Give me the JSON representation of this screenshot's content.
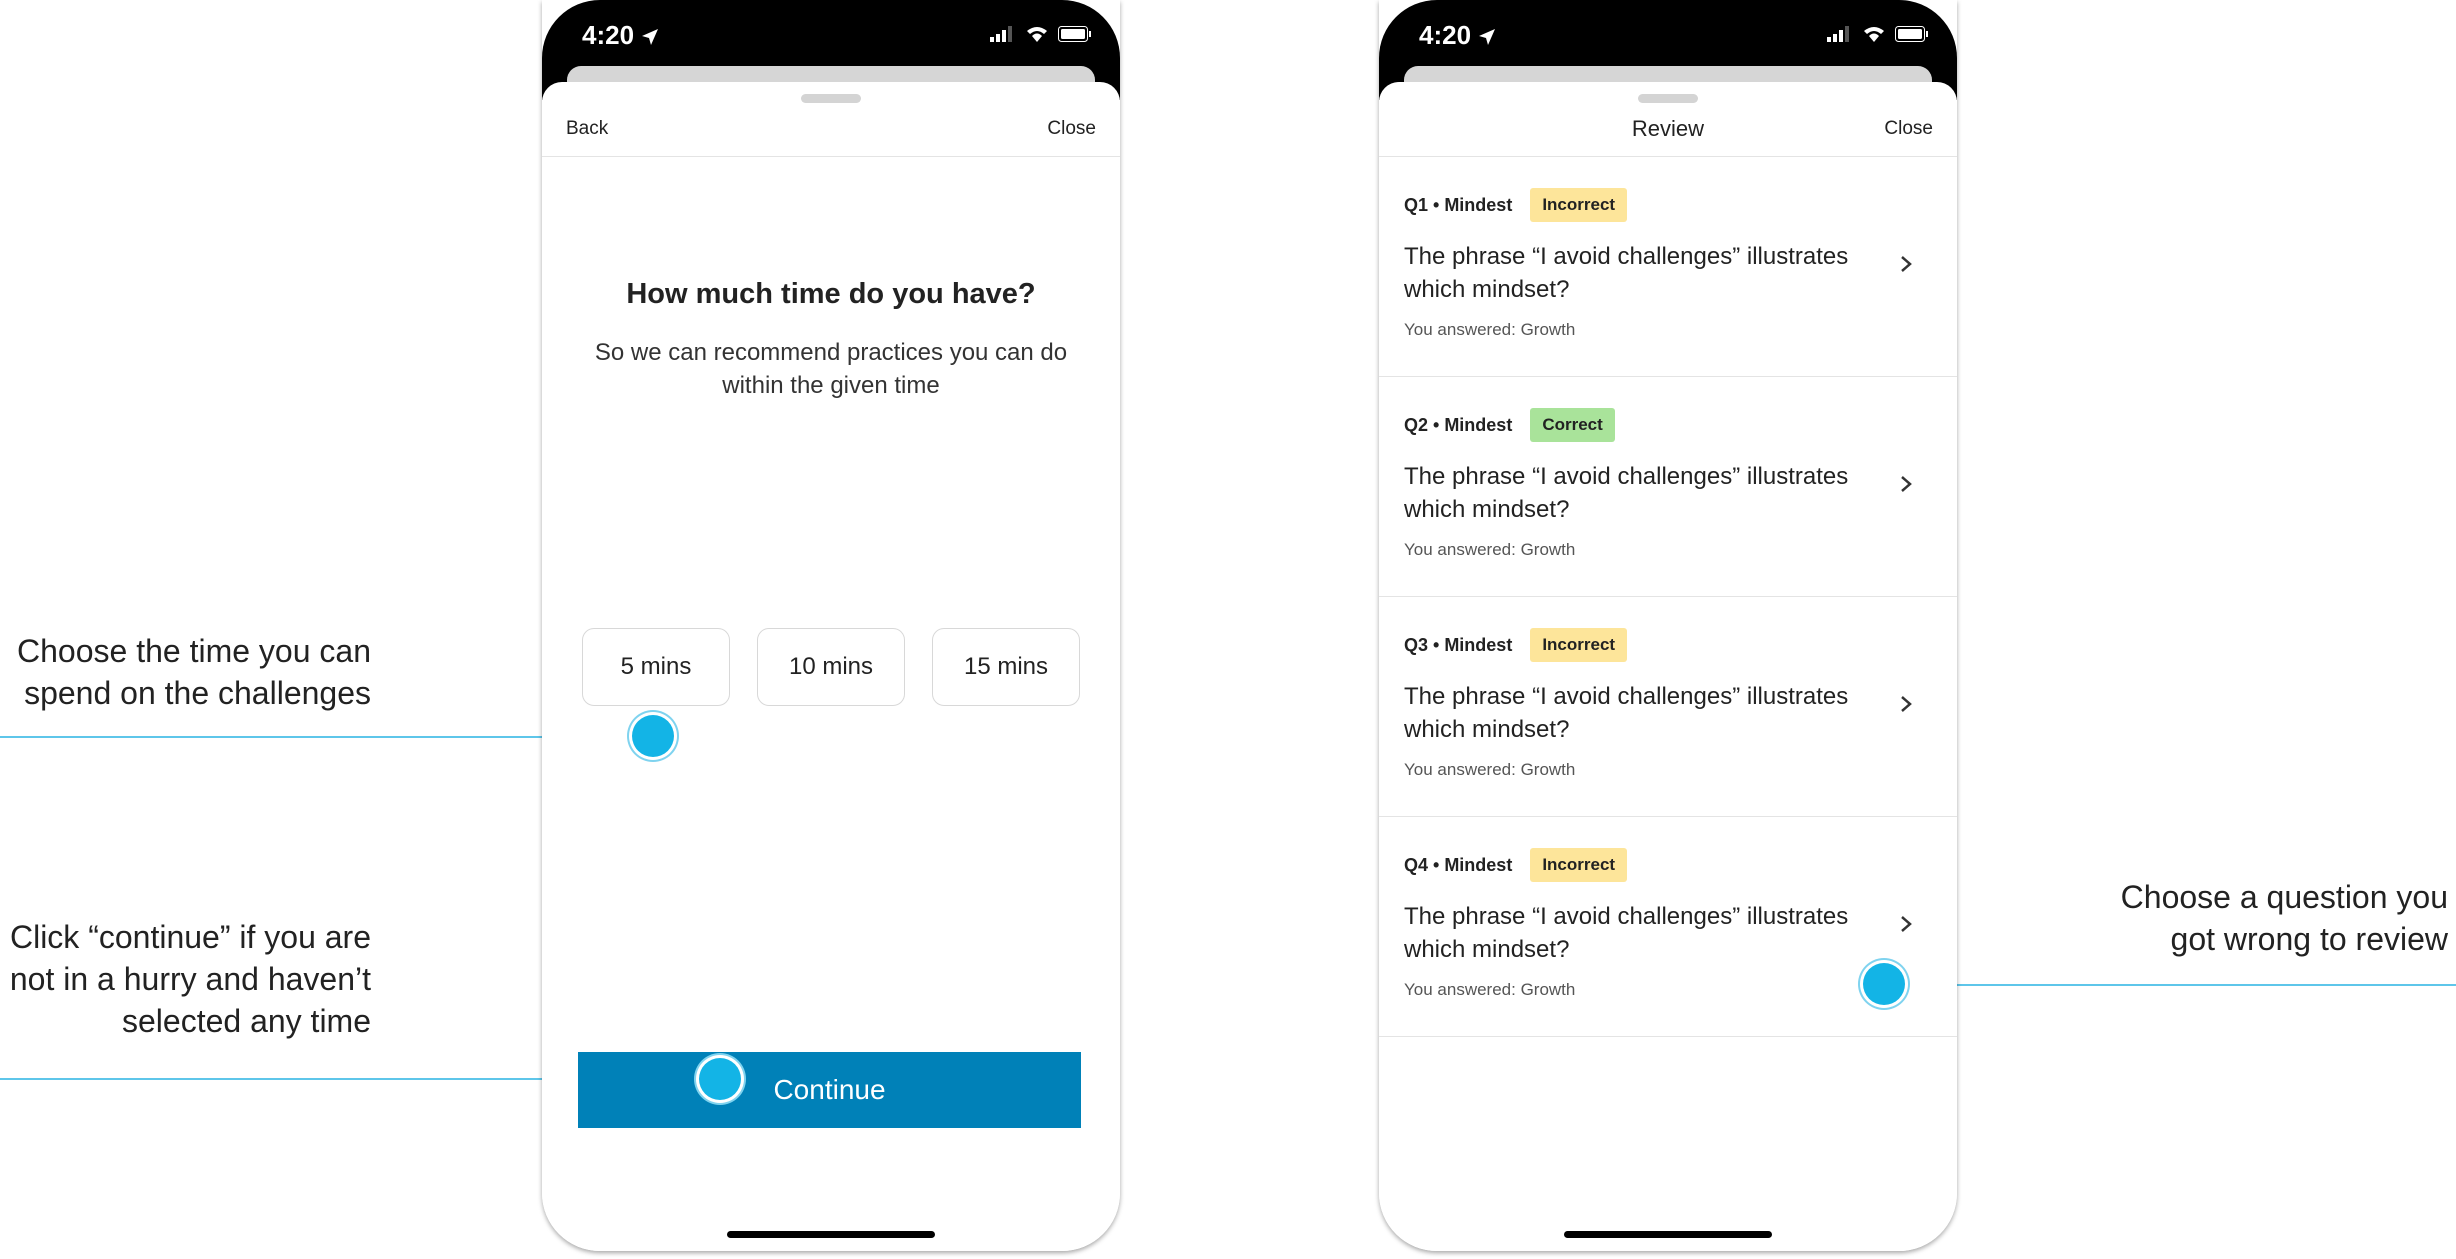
{
  "colors": {
    "accent": "#0081b8",
    "annotation_dot": "#13b4e6",
    "annotation_line": "#5ec6ea",
    "incorrect_badge": "#fde59a",
    "correct_badge": "#a9e39a"
  },
  "annotations": {
    "time": [
      "Choose the time you can",
      "spend on the challenges"
    ],
    "continue": [
      "Click “continue” if you are",
      "not in a hurry and haven’t",
      "selected any time"
    ],
    "review": [
      "Choose a question you",
      "got wrong to review"
    ]
  },
  "left_screen": {
    "status_time": "4:20",
    "nav": {
      "back": "Back",
      "close": "Close"
    },
    "title": "How much time do you have?",
    "subtitle": "So we can recommend practices you can do within the given time",
    "time_options": [
      "5 mins",
      "10 mins",
      "15 mins"
    ],
    "continue_label": "Continue"
  },
  "right_screen": {
    "status_time": "4:20",
    "nav": {
      "title": "Review",
      "close": "Close"
    },
    "questions": [
      {
        "meta": "Q1 • Mindest",
        "status": "Incorrect",
        "text": "The phrase “I avoid challenges” illustrates which mindset?",
        "answer": "You answered: Growth"
      },
      {
        "meta": "Q2 • Mindest",
        "status": "Correct",
        "text": "The phrase “I avoid challenges” illustrates which mindset?",
        "answer": "You answered: Growth"
      },
      {
        "meta": "Q3 • Mindest",
        "status": "Incorrect",
        "text": "The phrase “I avoid challenges” illustrates which mindset?",
        "answer": "You answered: Growth"
      },
      {
        "meta": "Q4 • Mindest",
        "status": "Incorrect",
        "text": "The phrase “I avoid challenges” illustrates which mindset?",
        "answer": "You answered: Growth"
      }
    ]
  }
}
